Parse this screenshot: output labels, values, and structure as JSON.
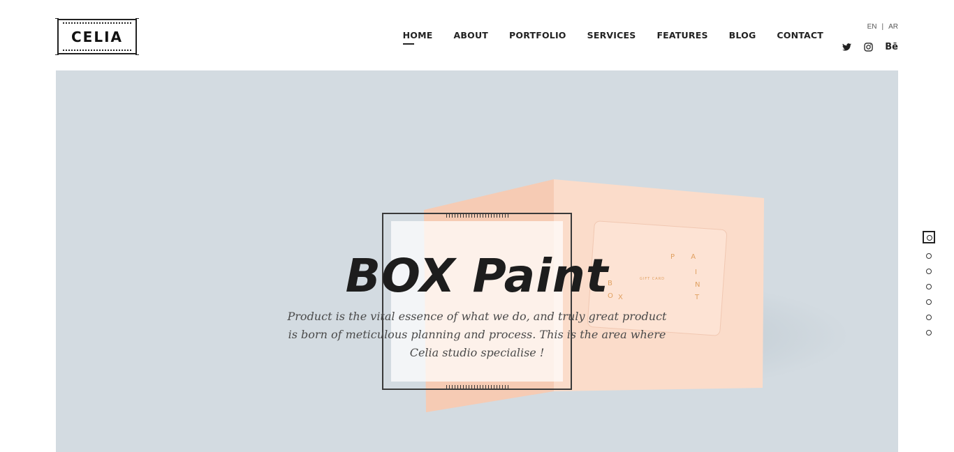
{
  "brand": {
    "logo_text": "CELIA"
  },
  "nav": {
    "items": [
      {
        "label": "HOME",
        "active": true
      },
      {
        "label": "ABOUT",
        "active": false
      },
      {
        "label": "PORTFOLIO",
        "active": false
      },
      {
        "label": "SERVICES",
        "active": false
      },
      {
        "label": "FEATURES",
        "active": false
      },
      {
        "label": "BLOG",
        "active": false
      },
      {
        "label": "CONTACT",
        "active": false
      }
    ]
  },
  "lang": {
    "en": "EN",
    "separator": "|",
    "ar": "AR"
  },
  "social": {
    "icons": [
      "twitter-icon",
      "instagram-icon",
      "behance-icon"
    ],
    "behance_label": "Bē"
  },
  "hero": {
    "title": "BOX Paint",
    "description": "Product is the vital essence of what we do, and truly great product is born of meticulous planning and process. This is the area where Celia studio specialise !",
    "background_color": "#d3dbe1",
    "card_color": "#f9d8c6",
    "card_letters": [
      "P",
      "A",
      "I",
      "N",
      "T",
      "B",
      "O",
      "X"
    ],
    "card_small_text": "GIFT CARD",
    "accent_color": "#e0a060"
  },
  "slides": {
    "count": 7,
    "active_index": 0
  }
}
